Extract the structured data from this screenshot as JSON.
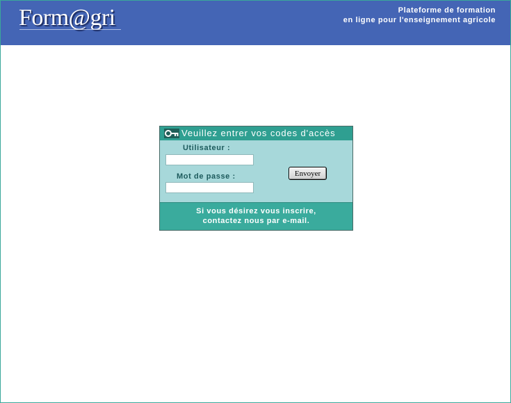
{
  "header": {
    "logo_text": "Form@gri",
    "tagline_line1": "Plateforme de formation",
    "tagline_line2": "en ligne pour l'enseignement agricole",
    "background_color": "#4465b5"
  },
  "login": {
    "title": "Veuillez entrer vos codes d'accès",
    "title_icon": "key-icon",
    "username_label": "Utilisateur :",
    "username_value": "",
    "password_label": "Mot de passe :",
    "password_value": "",
    "submit_label": "Envoyer",
    "footer_line1": "Si vous désirez vous inscrire,",
    "footer_line2": "contactez nous par e-mail.",
    "accent_color": "#2f9f91",
    "panel_color": "#a7d8da"
  }
}
